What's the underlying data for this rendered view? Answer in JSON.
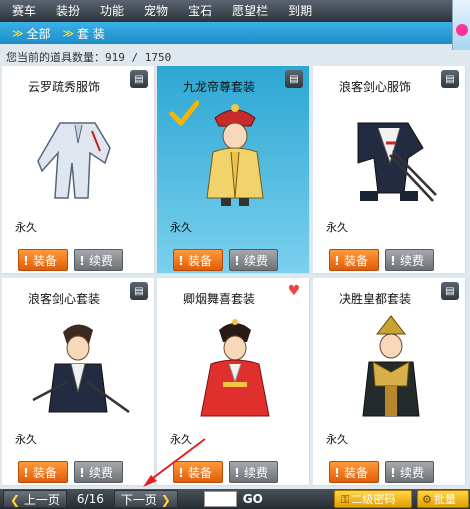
{
  "nav": {
    "items": [
      "赛车",
      "装扮",
      "功能",
      "宠物",
      "宝石",
      "愿望栏",
      "到期"
    ]
  },
  "subnav": {
    "items": [
      "全部",
      "套 装"
    ]
  },
  "inventory": {
    "count_label": "您当前的道具数量：",
    "count_value": "919 / 1750"
  },
  "cards": [
    {
      "title": "云罗疏秀服饰",
      "duration": "永久",
      "equip": "装备",
      "renew": "续费"
    },
    {
      "title": "九龙帝尊套装",
      "duration": "永久",
      "equip": "装备",
      "renew": "续费"
    },
    {
      "title": "浪客剑心服饰",
      "duration": "永久",
      "equip": "装备",
      "renew": "续费"
    },
    {
      "title": "浪客剑心套装",
      "duration": "永久",
      "equip": "装备",
      "renew": "续费"
    },
    {
      "title": "卿烟舞喜套装",
      "duration": "永久",
      "equip": "装备",
      "renew": "续费"
    },
    {
      "title": "决胜皇都套装",
      "duration": "永久",
      "equip": "装备",
      "renew": "续费"
    }
  ],
  "pager": {
    "prev": "上一页",
    "page": "6/16",
    "next": "下一页",
    "go": "GO",
    "secondary_password": "二级密码",
    "batch": "批量"
  },
  "colors": {
    "selected_card": "#2ca7d3",
    "equip_button": "#f07a1e",
    "renew_button": "#888c90",
    "top_nav": "#3a424b",
    "sub_nav": "#2aa0da"
  }
}
